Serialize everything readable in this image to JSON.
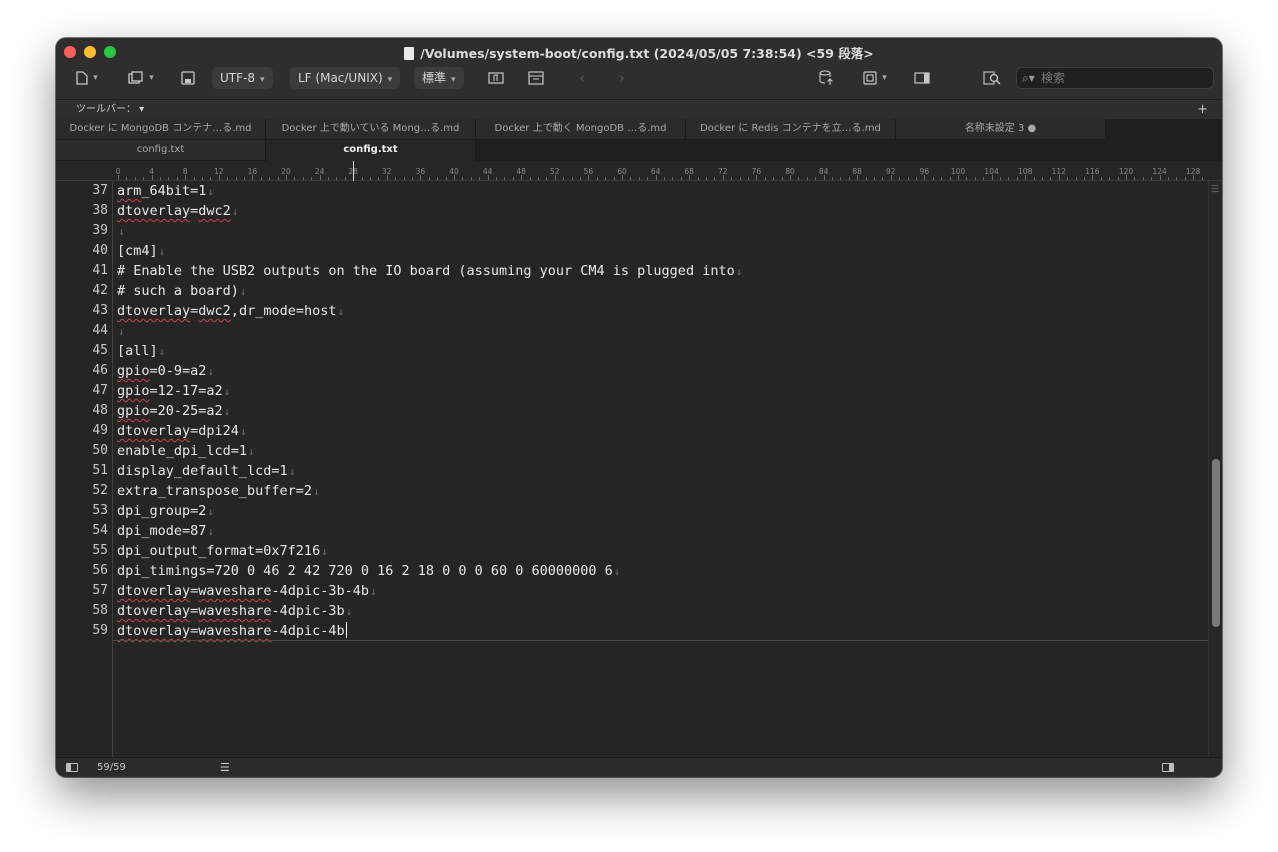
{
  "window": {
    "title": "/Volumes/system-boot/config.txt   (2024/05/05 7:38:54)   <59 段落>"
  },
  "toolbar": {
    "encoding": "UTF-8",
    "line_ending": "LF (Mac/UNIX)",
    "syntax": "標準",
    "search_placeholder": "検索",
    "toolbar_label": "ツールバー：",
    "add_label": "+"
  },
  "tabs": {
    "row1": [
      {
        "label": "Docker に MongoDB コンテナ…る.md"
      },
      {
        "label": "Docker 上で動いている Mong…る.md"
      },
      {
        "label": "Docker 上で動く MongoDB …る.md"
      },
      {
        "label": "Docker に Redis コンテナを立…る.md"
      },
      {
        "label": "名称未設定 3 ●"
      }
    ],
    "row2": [
      {
        "label": "config.txt"
      },
      {
        "label": "config.txt"
      }
    ]
  },
  "ruler": {
    "labels": [
      "0",
      "4",
      "8",
      "12",
      "16",
      "20",
      "24",
      "28",
      "32",
      "36",
      "40",
      "44",
      "48",
      "52",
      "56",
      "60",
      "64",
      "68",
      "72",
      "76",
      "80",
      "84",
      "88",
      "92",
      "96",
      "100",
      "104",
      "108",
      "112",
      "116",
      "120",
      "124",
      "128"
    ]
  },
  "editor": {
    "lines": [
      {
        "num": "37",
        "text": "arm_64bit=1"
      },
      {
        "num": "38",
        "text": "dtoverlay=dwc2"
      },
      {
        "num": "39",
        "text": ""
      },
      {
        "num": "40",
        "text": "[cm4]"
      },
      {
        "num": "41",
        "text": "# Enable the USB2 outputs on the IO board (assuming your CM4 is plugged into"
      },
      {
        "num": "42",
        "text": "# such a board)"
      },
      {
        "num": "43",
        "text": "dtoverlay=dwc2,dr_mode=host"
      },
      {
        "num": "44",
        "text": ""
      },
      {
        "num": "45",
        "text": "[all]"
      },
      {
        "num": "46",
        "text": "gpio=0-9=a2"
      },
      {
        "num": "47",
        "text": "gpio=12-17=a2"
      },
      {
        "num": "48",
        "text": "gpio=20-25=a2"
      },
      {
        "num": "49",
        "text": "dtoverlay=dpi24"
      },
      {
        "num": "50",
        "text": "enable_dpi_lcd=1"
      },
      {
        "num": "51",
        "text": "display_default_lcd=1"
      },
      {
        "num": "52",
        "text": "extra_transpose_buffer=2"
      },
      {
        "num": "53",
        "text": "dpi_group=2"
      },
      {
        "num": "54",
        "text": "dpi_mode=87"
      },
      {
        "num": "55",
        "text": "dpi_output_format=0x7f216"
      },
      {
        "num": "56",
        "text": "dpi_timings=720 0 46 2 42 720 0 16 2 18 0 0 0 60 0 60000000 6"
      },
      {
        "num": "57",
        "text": "dtoverlay=waveshare-4dpic-3b-4b"
      },
      {
        "num": "58",
        "text": "dtoverlay=waveshare-4dpic-3b"
      },
      {
        "num": "59",
        "text": "dtoverlay=waveshare-4dpic-4b"
      }
    ]
  },
  "status": {
    "position": "59/59"
  }
}
